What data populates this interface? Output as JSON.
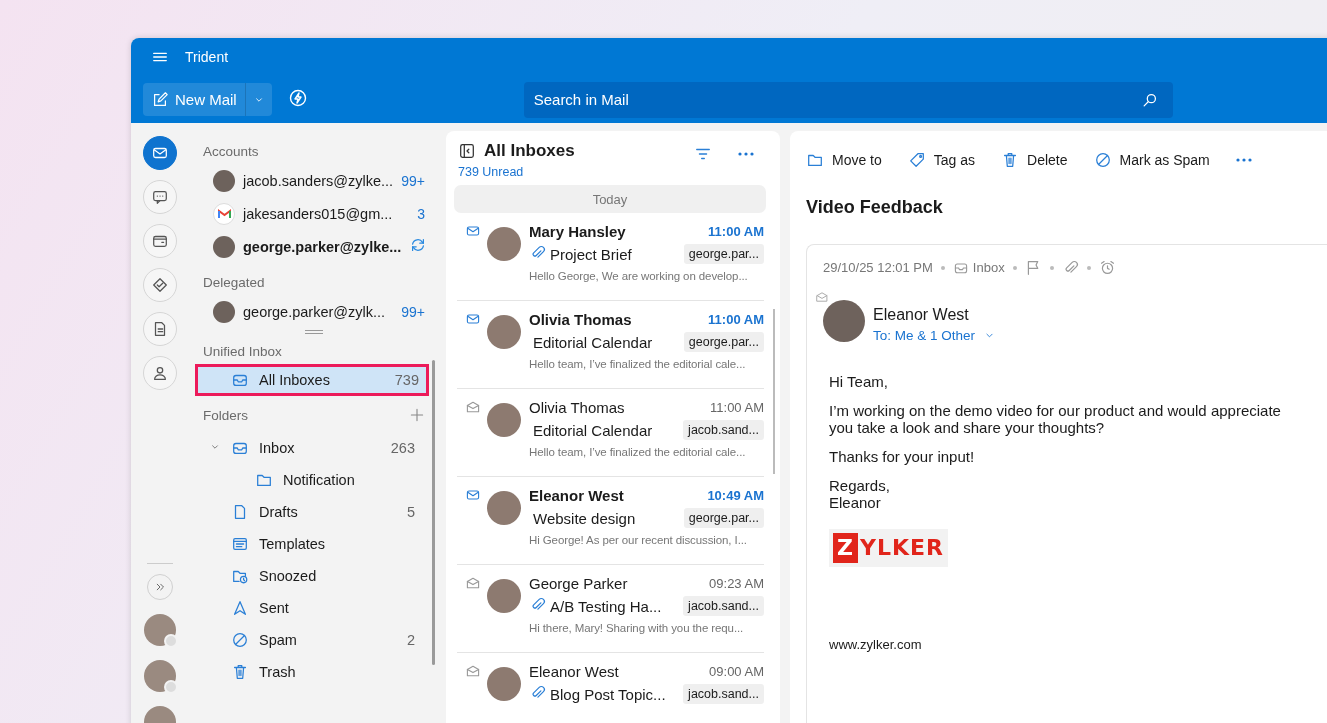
{
  "window": {
    "title": "Trident"
  },
  "toolbar": {
    "new_mail": "New Mail",
    "search": {
      "placeholder": "Search in Mail"
    }
  },
  "rail": [
    {
      "kind": "mail",
      "selected": true
    },
    {
      "kind": "chat",
      "selected": false
    },
    {
      "kind": "wallet",
      "selected": false
    },
    {
      "kind": "tasks",
      "selected": false
    },
    {
      "kind": "notes",
      "selected": false
    },
    {
      "kind": "contacts",
      "selected": false
    }
  ],
  "accounts": {
    "heading": "Accounts",
    "items": [
      {
        "email": "jacob.sanders@zylke...",
        "count": "99+",
        "kind": "photo",
        "active": false,
        "syncing": false
      },
      {
        "email": "jakesanders015@gm...",
        "count": "3",
        "kind": "gmail",
        "active": false,
        "syncing": false
      },
      {
        "email": "george.parker@zylke...",
        "kind": "photo",
        "active": true,
        "syncing": true
      }
    ]
  },
  "delegated": {
    "heading": "Delegated",
    "items": [
      {
        "email": "george.parker@zylk...",
        "count": "99+",
        "kind": "photo",
        "active": false,
        "syncing": false
      }
    ]
  },
  "unified_inbox": {
    "heading": "Unified Inbox",
    "items": [
      {
        "label": "All Inboxes",
        "count": "739",
        "selected": true,
        "highlighted": true
      }
    ]
  },
  "folders": {
    "heading": "Folders",
    "items": [
      {
        "label": "Inbox",
        "count": "263",
        "kind": "inbox",
        "expanded": true,
        "children": [
          {
            "label": "Notification",
            "kind": "folder"
          }
        ]
      },
      {
        "label": "Drafts",
        "count": "5",
        "kind": "drafts"
      },
      {
        "label": "Templates",
        "kind": "templates"
      },
      {
        "label": "Snoozed",
        "kind": "snoozed"
      },
      {
        "label": "Sent",
        "kind": "sent"
      },
      {
        "label": "Spam",
        "count": "2",
        "kind": "spam"
      },
      {
        "label": "Trash",
        "kind": "trash"
      }
    ]
  },
  "message_list": {
    "title": "All Inboxes",
    "unread": "739 Unread",
    "group": "Today",
    "messages": [
      {
        "sender": "Mary Hansley",
        "time": "11:00 AM",
        "subject": "Project Brief",
        "account": "george.par...",
        "preview": "Hello George, We are working on develop...",
        "unread": true,
        "attachment": true
      },
      {
        "sender": "Olivia Thomas",
        "time": "11:00 AM",
        "subject": "Editorial Calendar",
        "account": "george.par...",
        "preview": "Hello team, I’ve finalized the editorial cale...",
        "unread": true,
        "attachment": false
      },
      {
        "sender": "Olivia Thomas",
        "time": "11:00 AM",
        "subject": "Editorial Calendar",
        "account": "jacob.sand...",
        "preview": "Hello team, I’ve finalized the editorial cale...",
        "unread": false,
        "attachment": false
      },
      {
        "sender": "Eleanor West",
        "time": "10:49 AM",
        "subject": "Website design",
        "account": "george.par...",
        "preview": "Hi George! As per our recent discussion, I...",
        "unread": true,
        "attachment": false
      },
      {
        "sender": "George Parker",
        "time": "09:23 AM",
        "subject": "A/B Testing Ha...",
        "account": "jacob.sand...",
        "preview": "Hi there, Mary! Sharing with you the requ...",
        "unread": false,
        "attachment": true
      },
      {
        "sender": "Eleanor West",
        "time": "09:00 AM",
        "subject": "Blog Post Topic...",
        "account": "jacob.sand...",
        "unread": false,
        "attachment": true
      }
    ]
  },
  "reading": {
    "actions": [
      {
        "label": "Move to",
        "kind": "folder"
      },
      {
        "label": "Tag as",
        "kind": "tag"
      },
      {
        "label": "Delete",
        "kind": "trash"
      },
      {
        "label": "Mark as Spam",
        "kind": "spam"
      }
    ],
    "subject": "Video Feedback",
    "date": "29/10/25 12:01 PM",
    "folder": "Inbox",
    "sender": "Eleanor West",
    "recipients": "To: Me & 1 Other",
    "paragraphs": [
      [
        "Hi Team,"
      ],
      [
        "I’m working on the demo video for our product and would appreciate",
        "you take a look and share your thoughts?"
      ],
      [
        "Thanks for your input!"
      ],
      [
        "Regards,",
        "Eleanor"
      ]
    ],
    "logo": "ZYLKER",
    "website": "www.zylker.com"
  }
}
